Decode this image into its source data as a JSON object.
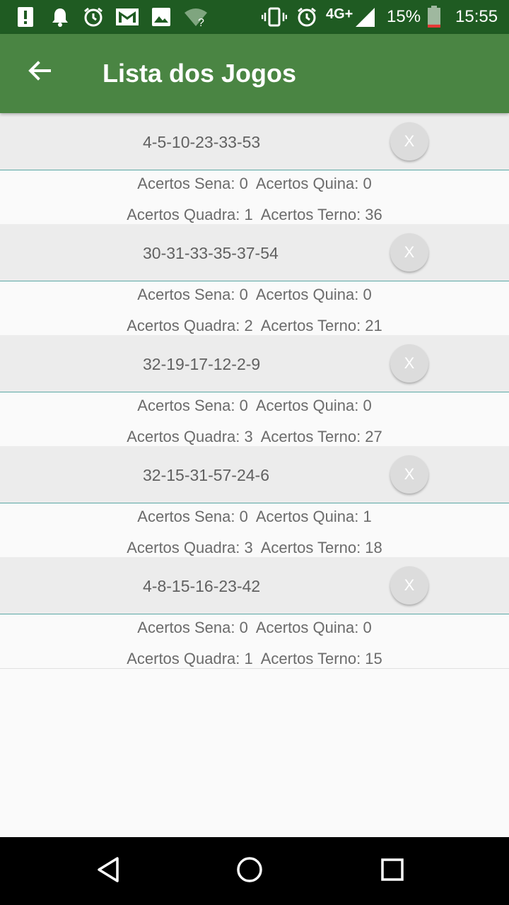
{
  "status_bar": {
    "icons_left": [
      "alert-icon",
      "notification-bell-icon",
      "alarm-icon",
      "gmail-icon",
      "image-icon",
      "wifi-question-icon"
    ],
    "icons_right": [
      "vibrate-icon",
      "alarm-icon",
      "signal-icon",
      "battery-icon"
    ],
    "network": "4G+",
    "battery": "15%",
    "battery_level": 0.15,
    "time": "15:55"
  },
  "app_bar": {
    "title": "Lista dos Jogos",
    "back_icon": "arrow-back-icon"
  },
  "games": [
    {
      "numbers": "4-5-10-23-33-53",
      "delete_label": "X",
      "line1": "Acertos Sena: 0  Acertos Quina: 0",
      "line2": "Acertos Quadra: 1  Acertos Terno: 36"
    },
    {
      "numbers": "30-31-33-35-37-54",
      "delete_label": "X",
      "line1": "Acertos Sena: 0  Acertos Quina: 0",
      "line2": "Acertos Quadra: 2  Acertos Terno: 21"
    },
    {
      "numbers": "32-19-17-12-2-9",
      "delete_label": "X",
      "line1": "Acertos Sena: 0  Acertos Quina: 0",
      "line2": "Acertos Quadra: 3  Acertos Terno: 27"
    },
    {
      "numbers": "32-15-31-57-24-6",
      "delete_label": "X",
      "line1": "Acertos Sena: 0  Acertos Quina: 1",
      "line2": "Acertos Quadra: 3  Acertos Terno: 18"
    },
    {
      "numbers": "4-8-15-16-23-42",
      "delete_label": "X",
      "line1": "Acertos Sena: 0  Acertos Quina: 0",
      "line2": "Acertos Quadra: 1  Acertos Terno: 15"
    }
  ],
  "nav_bar": {
    "icons": [
      "back-triangle-icon",
      "home-circle-icon",
      "recents-square-icon"
    ]
  },
  "colors": {
    "status_bar": "#1f5b22",
    "app_bar": "#4a8543",
    "row_header": "#ececec",
    "divider": "#5aa7a4",
    "delete_button": "#dcdcdc"
  }
}
